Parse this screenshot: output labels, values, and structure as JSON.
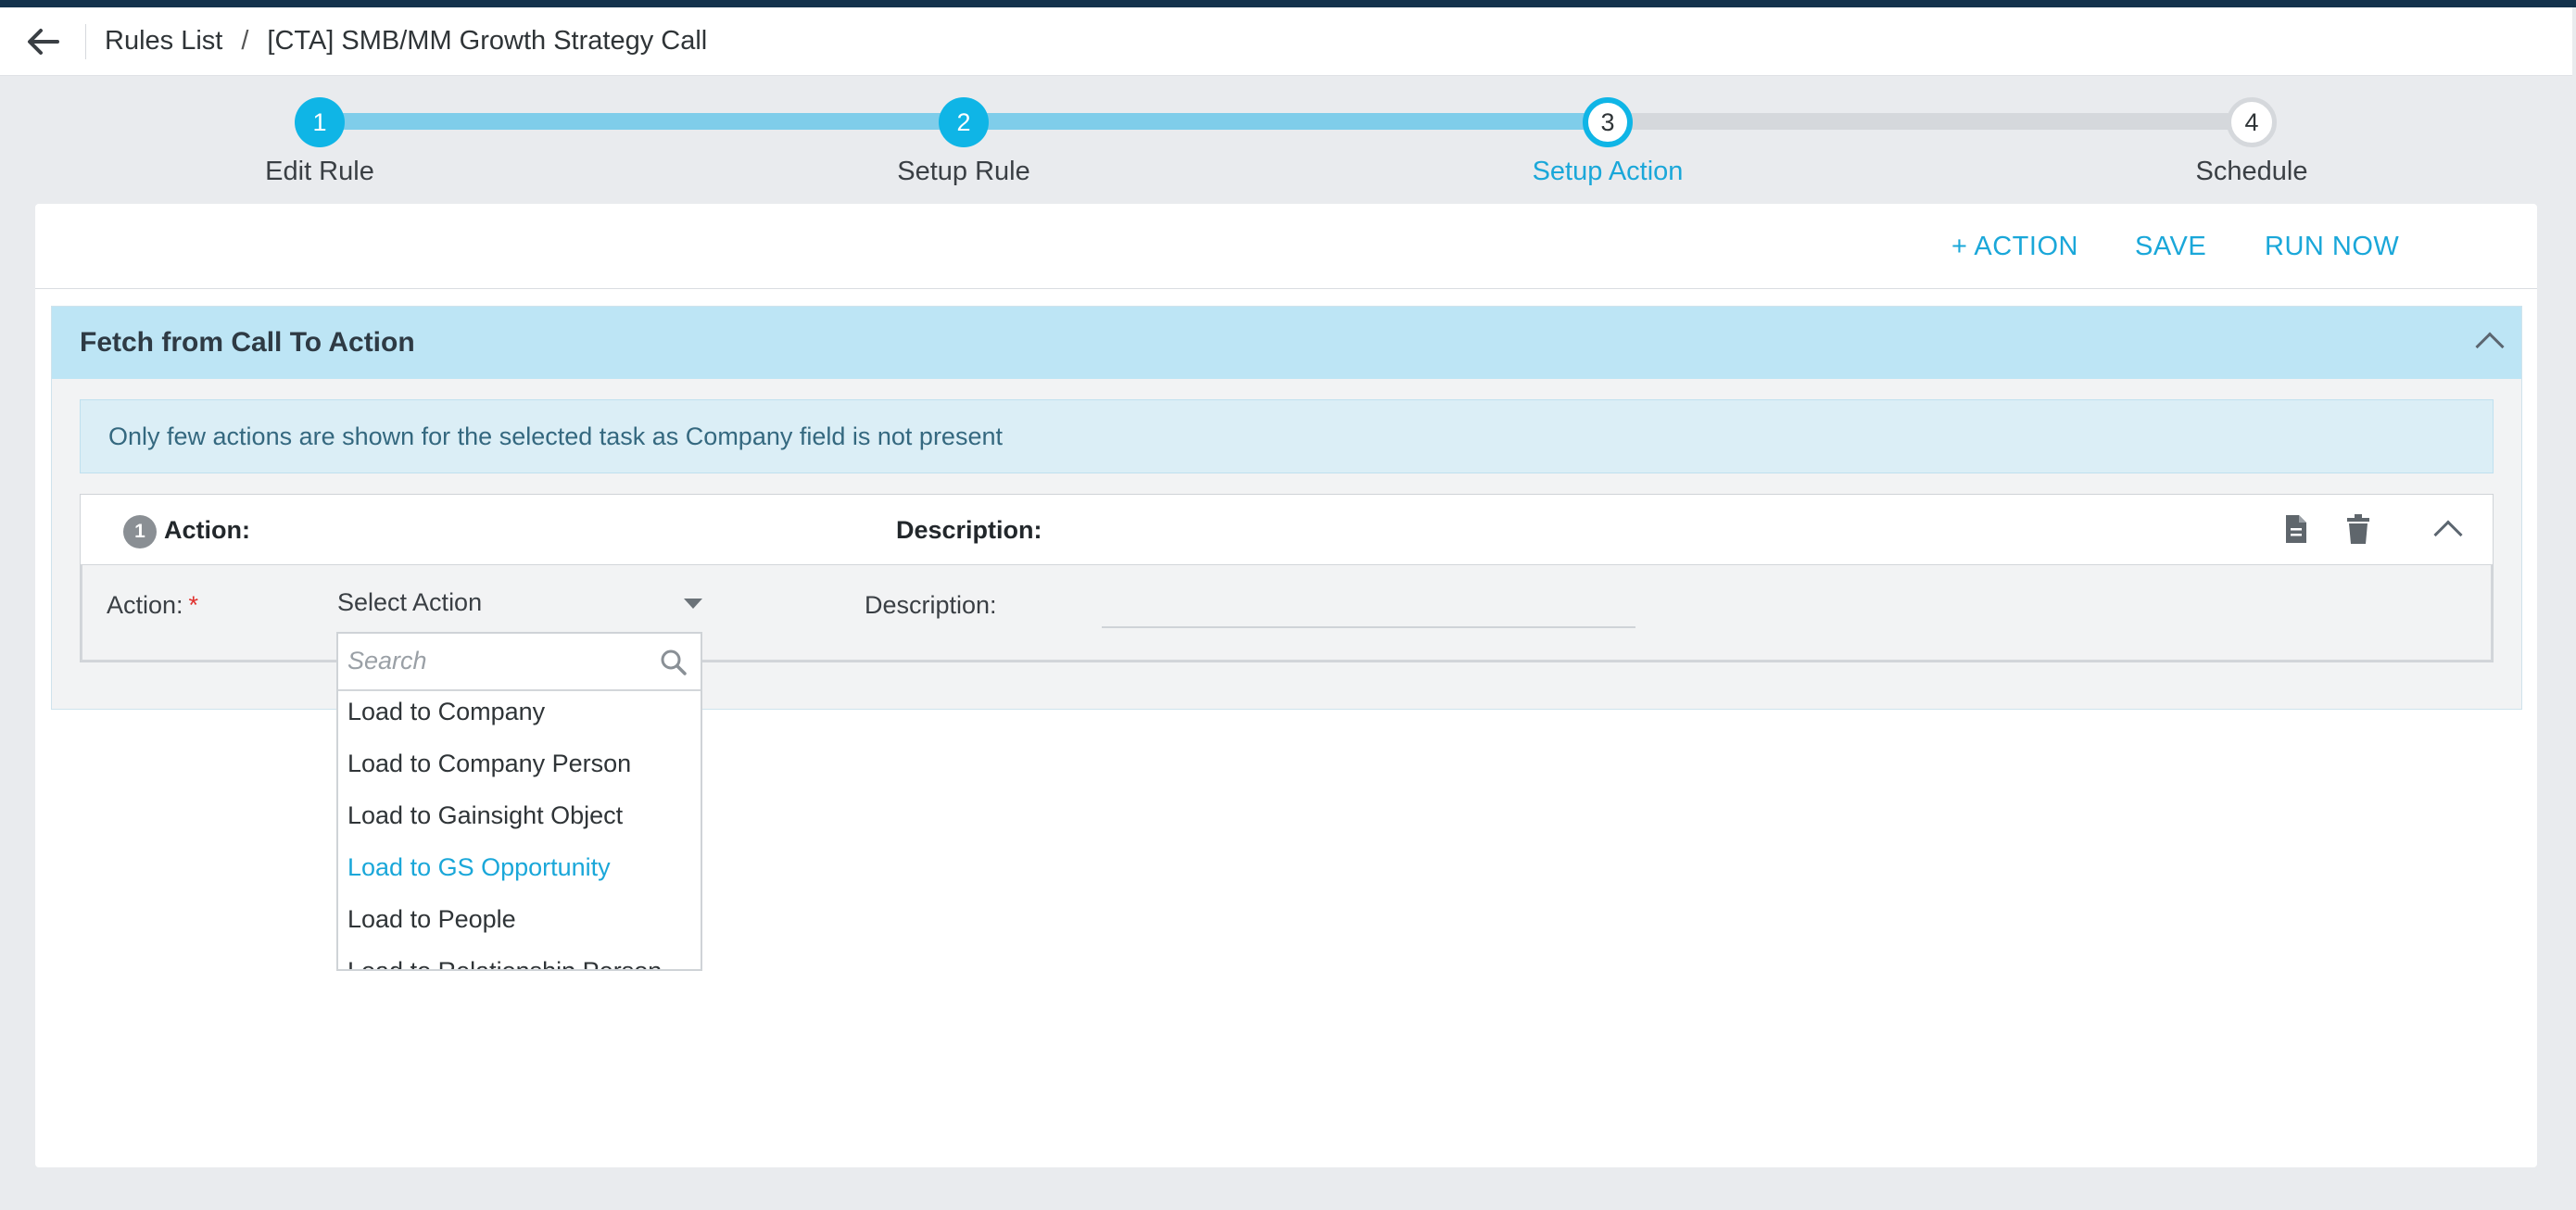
{
  "header": {
    "breadcrumb_root": "Rules List",
    "breadcrumb_sep": "/",
    "breadcrumb_current": "[CTA] SMB/MM Growth Strategy Call"
  },
  "stepper": {
    "steps": [
      {
        "num": "1",
        "label": "Edit Rule",
        "state": "done"
      },
      {
        "num": "2",
        "label": "Setup Rule",
        "state": "done"
      },
      {
        "num": "3",
        "label": "Setup Action",
        "state": "active"
      },
      {
        "num": "4",
        "label": "Schedule",
        "state": "todo"
      }
    ]
  },
  "toolbar": {
    "add_action": "+ ACTION",
    "save": "SAVE",
    "run_now": "RUN NOW"
  },
  "section": {
    "title": "Fetch from Call To Action",
    "notice": "Only few actions are shown for the selected task as Company field is not present"
  },
  "action": {
    "number": "1",
    "head_action_label": "Action:",
    "head_description_label": "Description:",
    "action_label": "Action:",
    "required_mark": "*",
    "select_value": "Select Action",
    "description_label": "Description:"
  },
  "dropdown": {
    "search_placeholder": "Search",
    "items": [
      "Load to Company",
      "Load to Company Person",
      "Load to Gainsight Object",
      "Load to GS Opportunity",
      "Load to People",
      "Load to Relationship Person"
    ],
    "highlighted": "Load to GS Opportunity"
  },
  "colors": {
    "accent": "#0fb5e6",
    "link": "#1aa7d9",
    "section_header": "#bde5f5",
    "notice_bg": "#dbeef6",
    "top_stripe": "#13324c"
  }
}
